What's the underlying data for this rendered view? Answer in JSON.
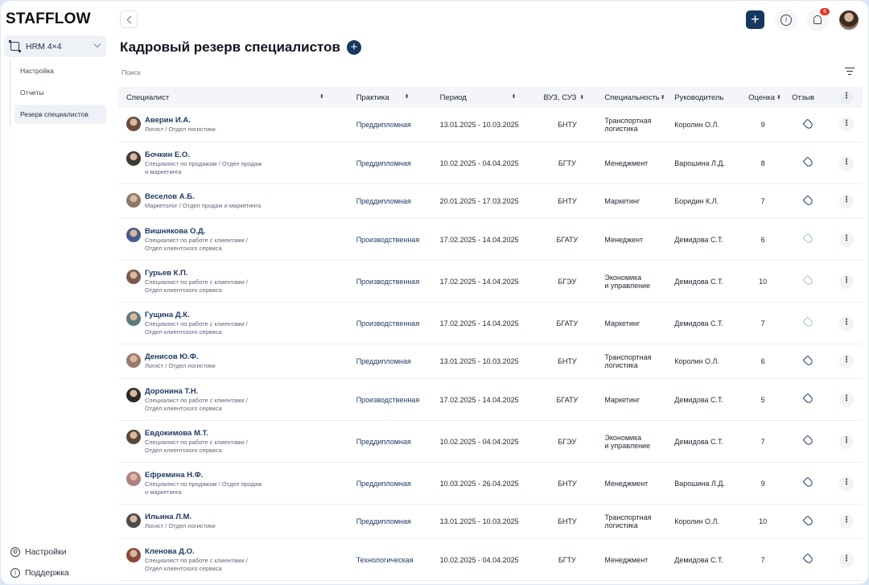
{
  "app": {
    "logo": "STAFFLOW"
  },
  "sidebar": {
    "module": "HRM 4×4",
    "items": [
      {
        "label": "Настройка"
      },
      {
        "label": "Отчеты"
      },
      {
        "label": "Резерв специалистов"
      }
    ],
    "bottom": [
      {
        "label": "Настройки"
      },
      {
        "label": "Поддержка"
      }
    ]
  },
  "header": {
    "title": "Кадровый резерв специалистов",
    "plus": "+",
    "notifications_count": "6",
    "info": "i"
  },
  "search": {
    "placeholder": "Поиск"
  },
  "table": {
    "columns": [
      "Специалист",
      "Практика",
      "Период",
      "ВУЗ, СУЗ",
      "Специальность",
      "Руководитель",
      "Оценка",
      "Отзыв"
    ],
    "rows": [
      {
        "name": "Аверин И.А.",
        "pos1": "Логист / Отдел логистики",
        "pos2": "",
        "practice": "Преддипломная",
        "period": "13.01.2025 - 10.03.2025",
        "uni": "БНТУ",
        "spec1": "Транспортная",
        "spec2": "логистика",
        "head": "Королин О.Л.",
        "score": "9",
        "review": true,
        "h": 43
      },
      {
        "name": "Бочкин Е.О.",
        "pos1": "Специалист по продажам / Отдел продаж",
        "pos2": "и маркетинга",
        "practice": "Преддипломная",
        "period": "10.02.2025 - 04.04.2025",
        "uni": "БГТУ",
        "spec1": "Менеджмент",
        "spec2": "",
        "head": "Варошина Л.Д.",
        "score": "8",
        "review": true,
        "h": 52
      },
      {
        "name": "Веселов А.Б.",
        "pos1": "Маркетолог / Отдел продаж и маркетинга",
        "pos2": "",
        "practice": "Преддипломная",
        "period": "20.01.2025 - 17.03.2025",
        "uni": "БНТУ",
        "spec1": "Маркетинг",
        "spec2": "",
        "head": "Боридин К.Л.",
        "score": "7",
        "review": true,
        "h": 43
      },
      {
        "name": "Вишнякова О.Д.",
        "pos1": "Специалист по работе с клиентами /",
        "pos2": "Отдел клиентского сервиса",
        "practice": "Производственная",
        "period": "17.02.2025 - 14.04.2025",
        "uni": "БГАТУ",
        "spec1": "Менеджент",
        "spec2": "",
        "head": "Демидова С.Т.",
        "score": "6",
        "review": false,
        "h": 52
      },
      {
        "name": "Гурьев К.П.",
        "pos1": "Специалист по работе с клиентами /",
        "pos2": "Отдел клиентского сервиса",
        "practice": "Производственная",
        "period": "17.02.2025 - 14.04.2025",
        "uni": "БГЭУ",
        "spec1": "Экономика",
        "spec2": "и управление",
        "head": "Демидова С.Т.",
        "score": "10",
        "review": false,
        "h": 52
      },
      {
        "name": "Гущина Д.К.",
        "pos1": "Специалист по работе с клиентами /",
        "pos2": "Отдел клиентского сервиса",
        "practice": "Производственная",
        "period": "17.02.2025 - 14.04.2025",
        "uni": "БГАТУ",
        "spec1": "Маркетинг",
        "spec2": "",
        "head": "Демидова С.Т.",
        "score": "7",
        "review": false,
        "h": 52
      },
      {
        "name": "Денисов Ю.Ф.",
        "pos1": "Логист / Отдел логистики",
        "pos2": "",
        "practice": "Преддипломная",
        "period": "13.01.2025 - 10.03.2025",
        "uni": "БНТУ",
        "spec1": "Транспортная",
        "spec2": "логистика",
        "head": "Королин О.Л.",
        "score": "6",
        "review": true,
        "h": 43
      },
      {
        "name": "Доронина Т.Н.",
        "pos1": "Специалист по работе с клиентами /",
        "pos2": "Отдел клиентского сервиса",
        "practice": "Производственная",
        "period": "17.02.2025 - 14.04.2025",
        "uni": "БГАТУ",
        "spec1": "Маркетинг",
        "spec2": "",
        "head": "Демидова С.Т.",
        "score": "5",
        "review": true,
        "h": 52
      },
      {
        "name": "Евдокимова М.Т.",
        "pos1": "Специалист по работе с клиентами /",
        "pos2": "Отдел клиентского сервиса",
        "practice": "Преддипломная",
        "period": "10.02.2025 - 04.04.2025",
        "uni": "БГЭУ",
        "spec1": "Экономика",
        "spec2": "и управление",
        "head": "Демидова С.Т.",
        "score": "7",
        "review": true,
        "h": 52
      },
      {
        "name": "Ефремина Н.Ф.",
        "pos1": "Специалист по продажам / Отдел продаж",
        "pos2": "и маркетинга",
        "practice": "Преддипломная",
        "period": "10.03.2025 - 26.04.2025",
        "uni": "БНТУ",
        "spec1": "Менеджмент",
        "spec2": "",
        "head": "Варошина Л.Д.",
        "score": "9",
        "review": true,
        "h": 52
      },
      {
        "name": "Ильина Л.М.",
        "pos1": "Логист / Отдел логистики",
        "pos2": "",
        "practice": "Преддипломная",
        "period": "13.01.2025 - 10.03.2025",
        "uni": "БНТУ",
        "spec1": "Транспортная",
        "spec2": "логистика",
        "head": "Королин О.Л.",
        "score": "10",
        "review": true,
        "h": 43
      },
      {
        "name": "Кленова Д.О.",
        "pos1": "Специалист по работе с клиентами /",
        "pos2": "Отдел клиентского сервиса",
        "practice": "Технологическая",
        "period": "10.02.2025 - 04.04.2025",
        "uni": "БГТУ",
        "spec1": "Менеджмент",
        "spec2": "",
        "head": "Демидова С.Т.",
        "score": "7",
        "review": true,
        "h": 52
      }
    ]
  },
  "colors": {
    "accent": "#17375e",
    "badge": "#e03a2f"
  }
}
